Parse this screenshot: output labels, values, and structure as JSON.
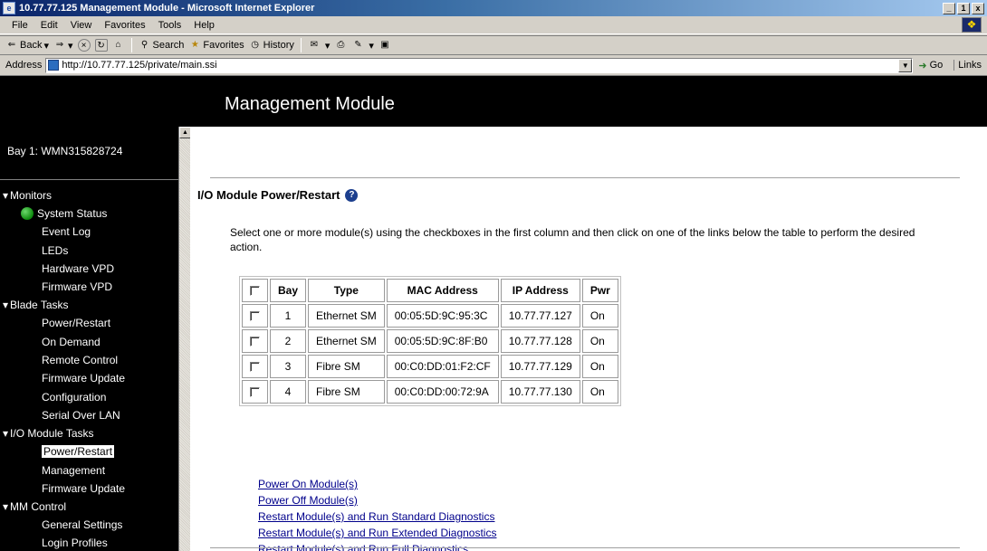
{
  "window": {
    "title": "10.77.77.125 Management Module - Microsoft Internet Explorer",
    "minimize": "_",
    "restore": "1",
    "close": "x"
  },
  "menu": [
    "File",
    "Edit",
    "View",
    "Favorites",
    "Tools",
    "Help"
  ],
  "toolbar": {
    "back": "Back",
    "search": "Search",
    "favorites": "Favorites",
    "history": "History"
  },
  "address": {
    "label": "Address",
    "url": "http://10.77.77.125/private/main.ssi",
    "go": "Go",
    "links": "Links"
  },
  "banner": {
    "title": "Management Module"
  },
  "sidebar": {
    "bay": "Bay 1: WMN315828724",
    "groups": [
      {
        "label": "Monitors",
        "items": [
          "System Status",
          "Event Log",
          "LEDs",
          "Hardware VPD",
          "Firmware VPD"
        ]
      },
      {
        "label": "Blade Tasks",
        "items": [
          "Power/Restart",
          "On Demand",
          "Remote Control",
          "Firmware Update",
          "Configuration",
          "Serial Over LAN"
        ]
      },
      {
        "label": "I/O Module Tasks",
        "items": [
          "Power/Restart",
          "Management",
          "Firmware Update"
        ]
      },
      {
        "label": "MM Control",
        "items": [
          "General Settings",
          "Login Profiles"
        ]
      }
    ]
  },
  "main": {
    "heading": "I/O Module Power/Restart",
    "instructions": "Select one or more module(s) using the checkboxes in the first column and then click on one of the links below the table to perform the desired action.",
    "table": {
      "headers": [
        "Bay",
        "Type",
        "MAC Address",
        "IP Address",
        "Pwr"
      ],
      "rows": [
        {
          "bay": "1",
          "type": "Ethernet SM",
          "mac": "00:05:5D:9C:95:3C",
          "ip": "10.77.77.127",
          "pwr": "On"
        },
        {
          "bay": "2",
          "type": "Ethernet SM",
          "mac": "00:05:5D:9C:8F:B0",
          "ip": "10.77.77.128",
          "pwr": "On"
        },
        {
          "bay": "3",
          "type": "Fibre SM",
          "mac": "00:C0:DD:01:F2:CF",
          "ip": "10.77.77.129",
          "pwr": "On"
        },
        {
          "bay": "4",
          "type": "Fibre SM",
          "mac": "00:C0:DD:00:72:9A",
          "ip": "10.77.77.130",
          "pwr": "On"
        }
      ]
    },
    "actions": [
      "Power On Module(s)",
      "Power Off Module(s)",
      "Restart Module(s) and Run Standard Diagnostics",
      "Restart Module(s) and Run Extended Diagnostics",
      "Restart Module(s) and Run Full Diagnostics"
    ]
  },
  "colors": {
    "banner": "#000000",
    "titlebar": "#0a246a",
    "link": "#00008b",
    "status_ok": "#0d8a0d"
  }
}
